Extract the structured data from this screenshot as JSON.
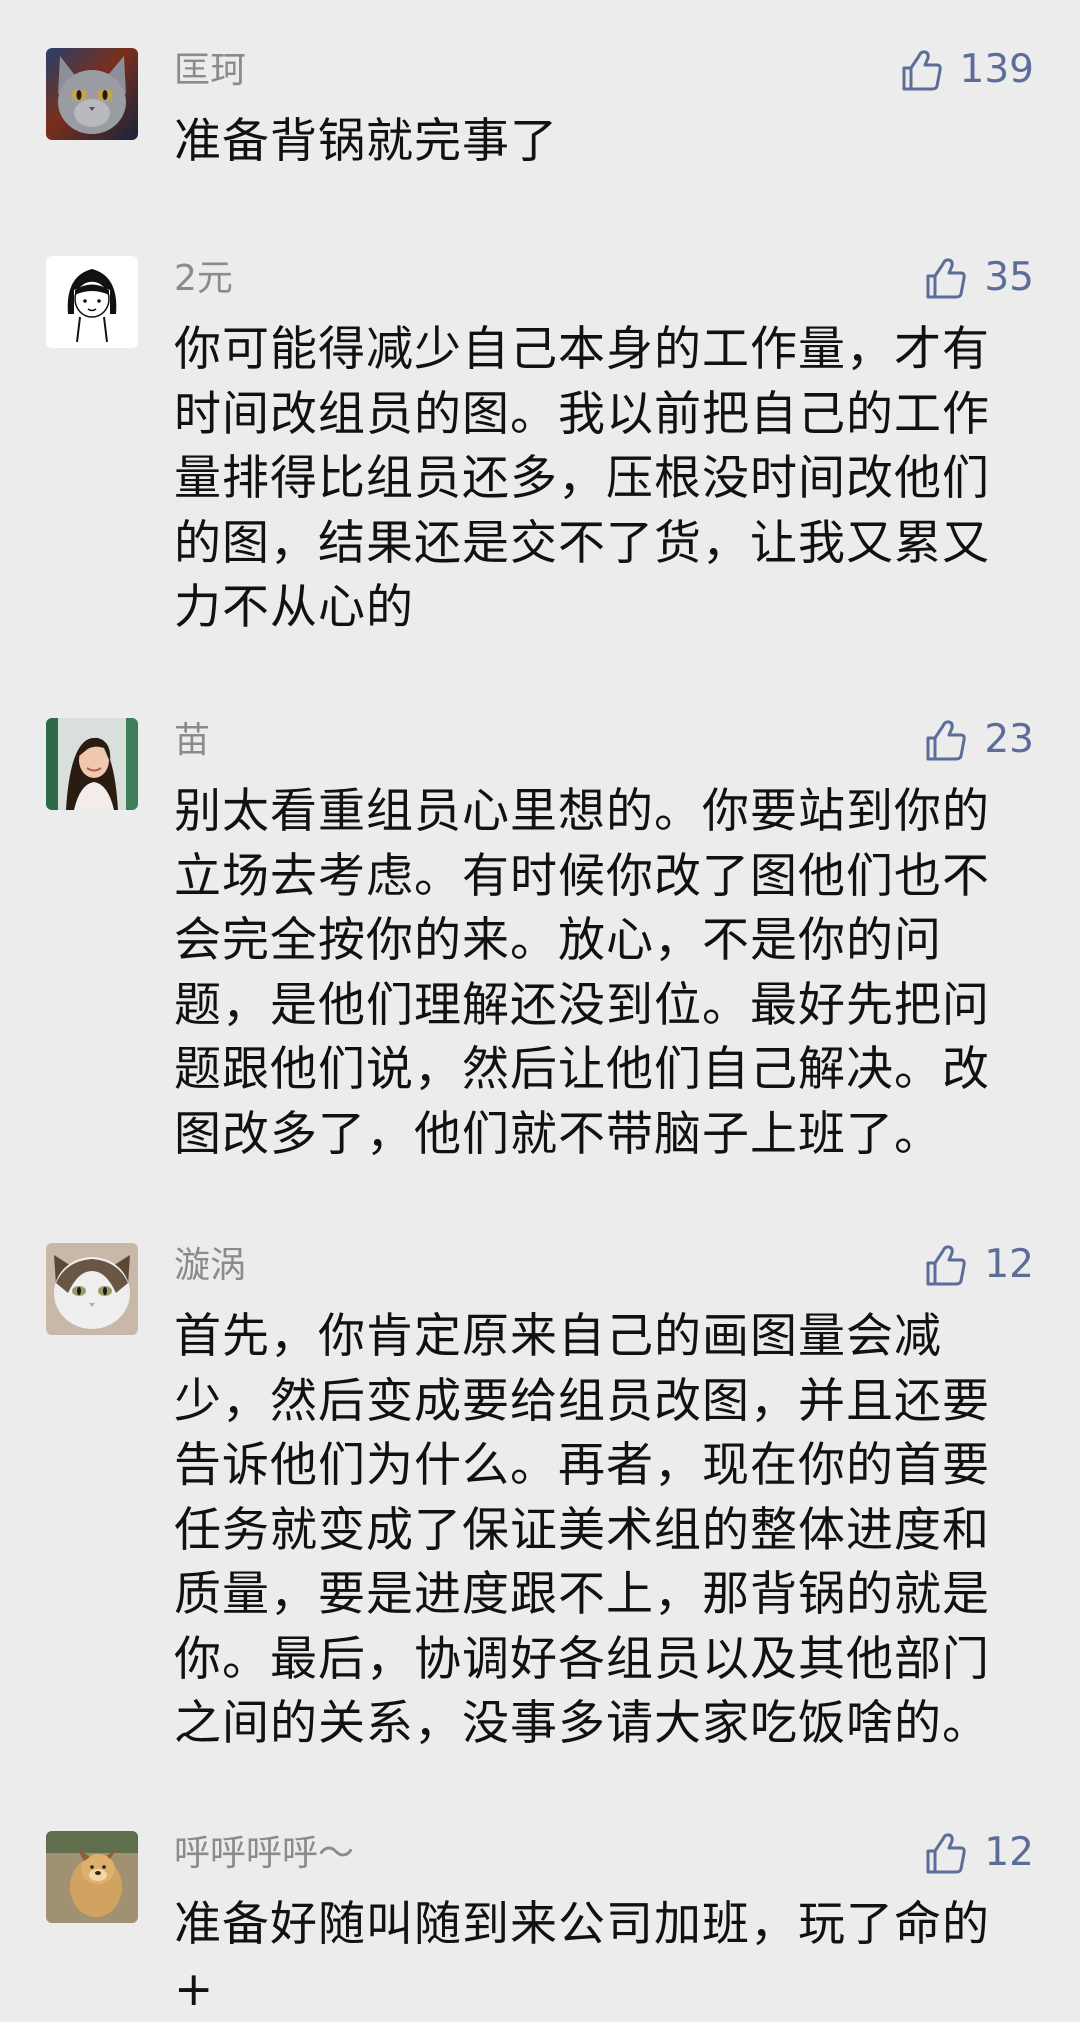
{
  "comments": [
    {
      "author": "匡珂",
      "likes": "139",
      "text": "准备背锅就完事了",
      "avatar": "gray-cat-avatar",
      "like_icon": "thumbs-up-icon"
    },
    {
      "author": "2元",
      "likes": "35",
      "text": "你可能得减少自己本身的工作量，才有时间改组员的图。我以前把自己的工作量排得比组员还多，压根没时间改他们的图，结果还是交不了货，让我又累又力不从心的",
      "avatar": "cartoon-girl-avatar",
      "like_icon": "thumbs-up-icon"
    },
    {
      "author": "苗",
      "likes": "23",
      "text": "别太看重组员心里想的。你要站到你的立场去考虑。有时候你改了图他们也不会完全按你的来。放心，不是你的问题，是他们理解还没到位。最好先把问题跟他们说，然后让他们自己解决。改图改多了，他们就不带脑子上班了。",
      "avatar": "woman-photo-avatar",
      "like_icon": "thumbs-up-icon"
    },
    {
      "author": "漩涡",
      "likes": "12",
      "text": "首先，你肯定原来自己的画图量会减少，然后变成要给组员改图，并且还要告诉他们为什么。再者，现在你的首要任务就变成了保证美术组的整体进度和质量，要是进度跟不上，那背锅的就是你。最后，协调好各组员以及其他部门之间的关系，没事多请大家吃饭啥的。",
      "avatar": "tabby-cat-avatar",
      "like_icon": "thumbs-up-icon"
    },
    {
      "author": "呼呼呼呼～",
      "likes": "12",
      "text": "准备好随叫随到来公司加班，玩了命的+",
      "avatar": "dog-photo-avatar",
      "like_icon": "thumbs-up-icon"
    }
  ],
  "colors": {
    "background": "#ececec",
    "author_name": "#8b8b8b",
    "like_accent": "#5d6d99",
    "comment_text": "#111111"
  }
}
